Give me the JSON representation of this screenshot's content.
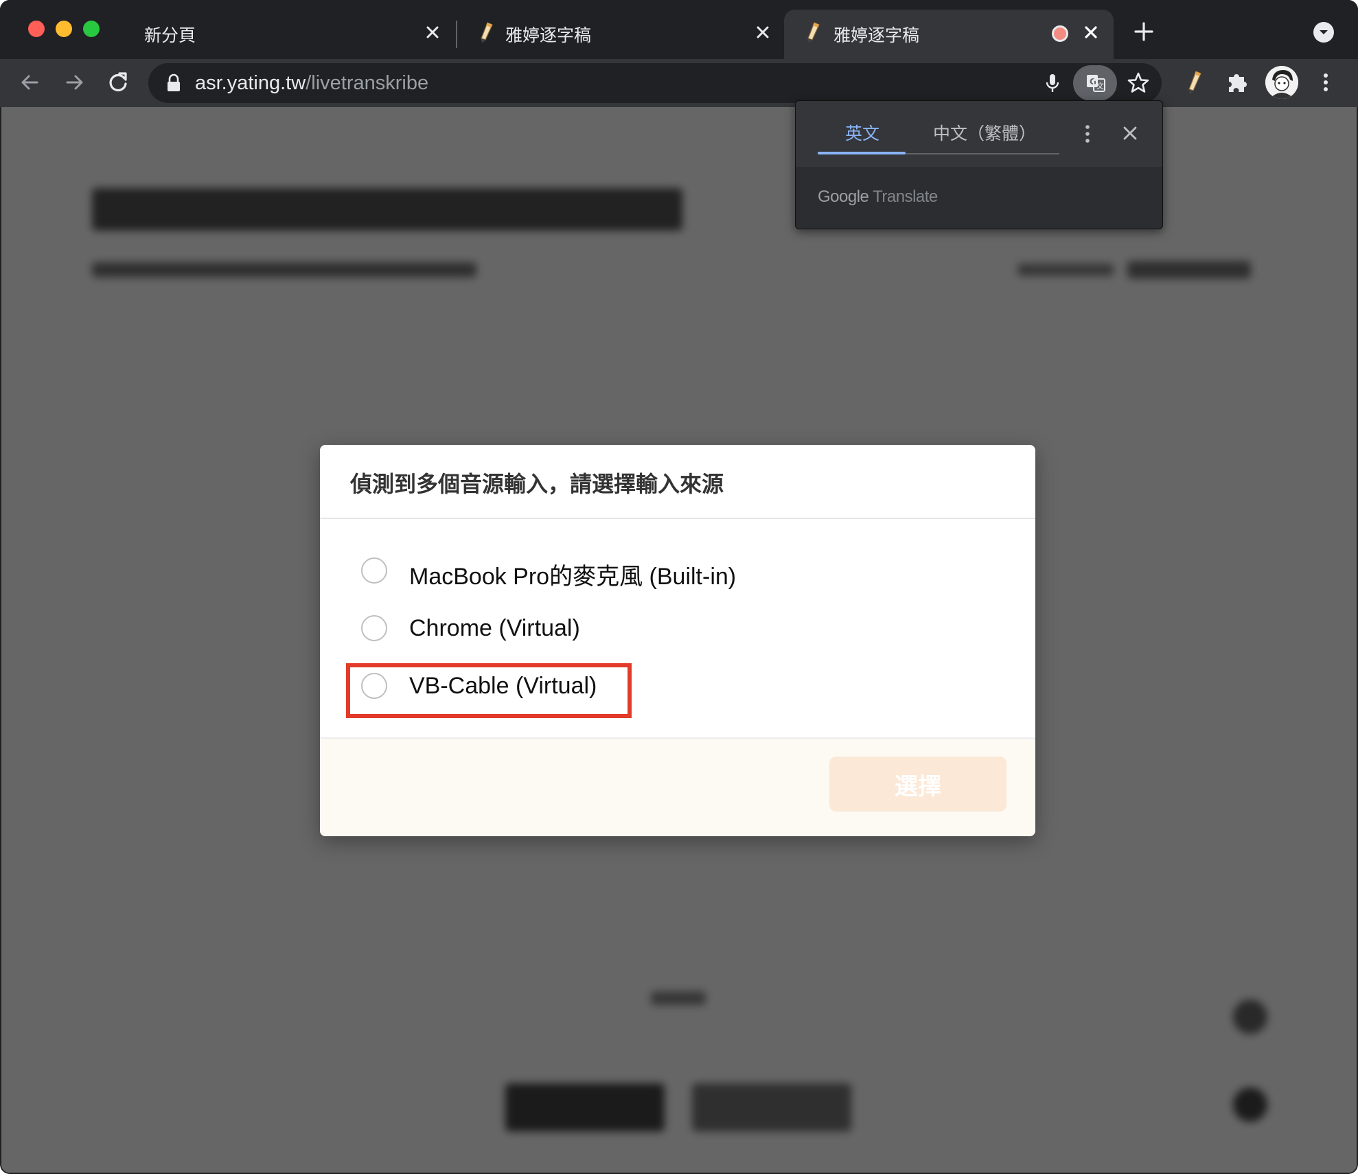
{
  "browser": {
    "tabs": [
      {
        "title": "新分頁"
      },
      {
        "title": "雅婷逐字稿"
      },
      {
        "title": "雅婷逐字稿",
        "recording": true
      }
    ],
    "url_host": "asr.yating.tw",
    "url_path": "/livetranskribe"
  },
  "translate_bubble": {
    "tab_source": "英文",
    "tab_target": "中文（繁體）",
    "brand_google": "Google",
    "brand_translate": "Translate"
  },
  "dialog": {
    "title": "偵測到多個音源輸入，請選擇輸入來源",
    "options": [
      {
        "label": "MacBook Pro的麥克風 (Built-in)"
      },
      {
        "label": "Chrome (Virtual)"
      },
      {
        "label": "VB-Cable (Virtual)"
      }
    ],
    "select_button": "選擇"
  },
  "colors": {
    "highlight": "#e23b2a",
    "accent_blue": "#8ab4f8",
    "select_button_bg": "#fbe8d6"
  },
  "icons": [
    "back-arrow-icon",
    "forward-arrow-icon",
    "reload-icon",
    "lock-icon",
    "microphone-icon",
    "translate-icon",
    "star-icon",
    "yating-extension-icon",
    "puzzle-extensions-icon",
    "profile-avatar",
    "more-vert-icon",
    "close-icon",
    "plus-icon",
    "tab-search-icon"
  ]
}
